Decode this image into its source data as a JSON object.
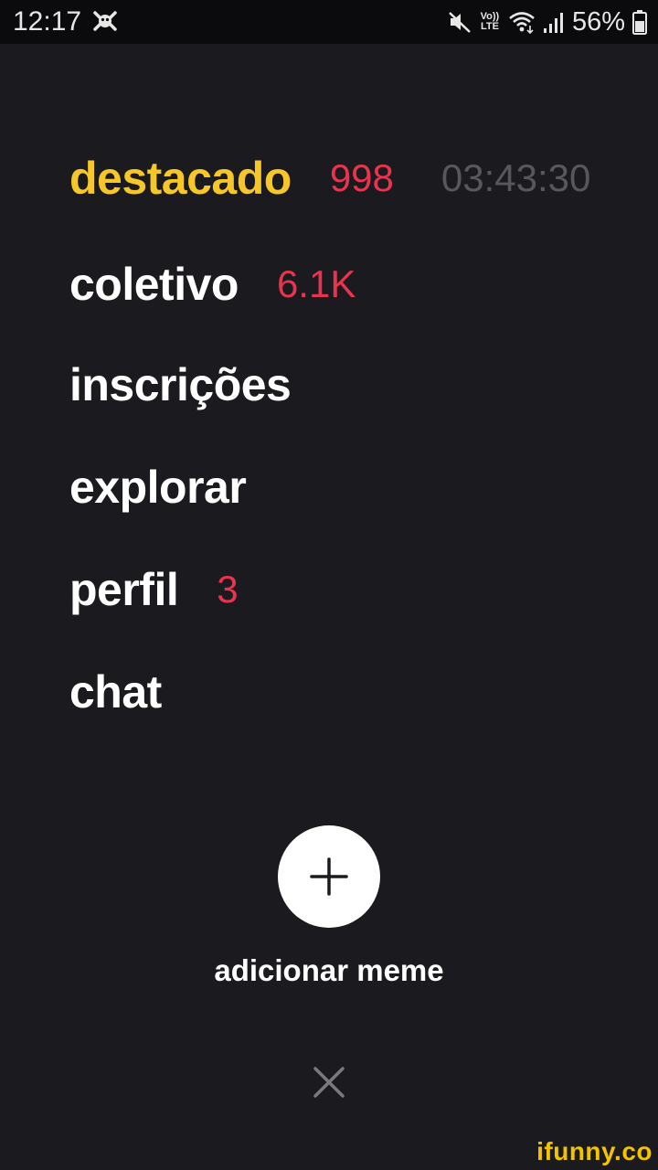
{
  "status_bar": {
    "time": "12:17",
    "app_icon": "ifunny-notification-icon",
    "mute_icon": "mute-icon",
    "volte_top": "Vo))",
    "volte_bottom": "LTE",
    "wifi_icon": "wifi-icon",
    "signal_icon": "signal-icon",
    "battery_percent": "56%",
    "battery_icon": "battery-icon"
  },
  "menu": {
    "items": [
      {
        "label": "destacado",
        "count": "998",
        "timer": "03:43:30",
        "active": true
      },
      {
        "label": "coletivo",
        "count": "6.1K"
      },
      {
        "label": "inscrições"
      },
      {
        "label": "explorar"
      },
      {
        "label": "perfil",
        "count": "3"
      },
      {
        "label": "chat"
      }
    ]
  },
  "add_meme": {
    "icon": "plus-icon",
    "label": "adicionar meme"
  },
  "close": {
    "icon": "close-icon"
  },
  "watermark": "ifunny.co",
  "colors": {
    "background": "#1b1b1f",
    "active": "#f7c72a",
    "count": "#e8344f",
    "timer": "#57575c",
    "text": "#ffffff"
  }
}
